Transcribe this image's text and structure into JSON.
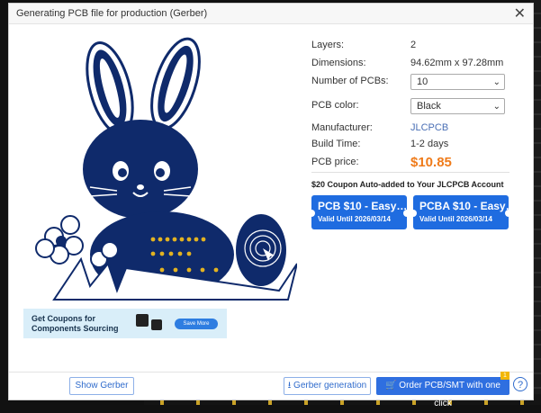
{
  "dialog": {
    "title": "Generating PCB file for production (Gerber)",
    "close_label": "✕"
  },
  "specs": {
    "layers_label": "Layers:",
    "layers_value": "2",
    "dimensions_label": "Dimensions:",
    "dimensions_value": "94.62mm x 97.28mm",
    "num_label": "Number of PCBs:",
    "num_value": "10",
    "color_label": "PCB color:",
    "color_value": "Black",
    "manufacturer_label": "Manufacturer:",
    "manufacturer_value": "JLCPCB",
    "build_label": "Build Time:",
    "build_value": "1-2 days",
    "price_label": "PCB price:",
    "price_value": "$10.85"
  },
  "coupons": {
    "heading": "$20 Coupon Auto-added to Your JLCPCB Account",
    "items": [
      {
        "title": "PCB $10 - Easy…",
        "validity": "Valid Until 2026/03/14"
      },
      {
        "title": "PCBA $10 - Easy…",
        "validity": "Valid Until 2026/03/14"
      }
    ]
  },
  "banner": {
    "text": "Get Coupons for Components Sourcing",
    "button": "Save More"
  },
  "footer": {
    "show_gerber": "Show Gerber",
    "gerber_generation": "Gerber generation",
    "order": "Order PCB/SMT with one click",
    "badge": "1",
    "help": "?"
  },
  "colors": {
    "accent": "#1f6ce0",
    "price": "#ef7b1a",
    "pcb": "#0f2a6b"
  },
  "icons": [
    "close-icon",
    "download-icon",
    "cart-icon",
    "help-icon",
    "chevron-down-icon"
  ]
}
